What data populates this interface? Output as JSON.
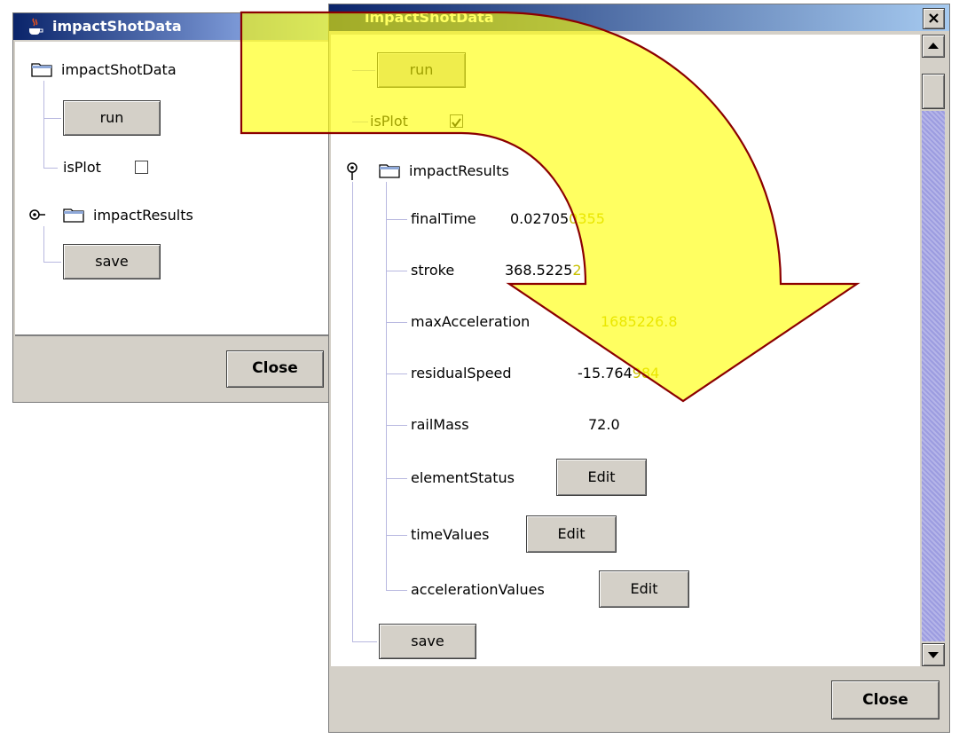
{
  "left_window": {
    "title": "impactShotData",
    "root_label": "impactShotData",
    "run_label": "run",
    "isplot_label": "isPlot",
    "results_label": "impactResults",
    "save_label": "save",
    "close_label": "Close"
  },
  "right_window": {
    "title": "impactShotData",
    "run_label": "run",
    "isplot_label": "isPlot",
    "results_label": "impactResults",
    "fields": [
      {
        "label": "finalTime",
        "value_a": "0.02705",
        "value_b": "0355"
      },
      {
        "label": "stroke",
        "value_a": "368.5225",
        "value_b": "2"
      },
      {
        "label": "maxAcceleration",
        "value_a": "",
        "value_b": "1685226.8"
      },
      {
        "label": "residualSpeed",
        "value_a": "-15.764",
        "value_b": "984"
      },
      {
        "label": "railMass",
        "value_a": "72.0",
        "value_b": ""
      }
    ],
    "edit_rows": [
      {
        "label": "elementStatus",
        "button": "Edit"
      },
      {
        "label": "timeValues",
        "button": "Edit"
      },
      {
        "label": "accelerationValues",
        "button": "Edit"
      }
    ],
    "save_label": "save",
    "close_label": "Close",
    "close_x_label": "×"
  },
  "colors": {
    "arrow_fill": "#ffff00",
    "arrow_stroke": "#8b0000",
    "title_blue": "#0a246a"
  }
}
